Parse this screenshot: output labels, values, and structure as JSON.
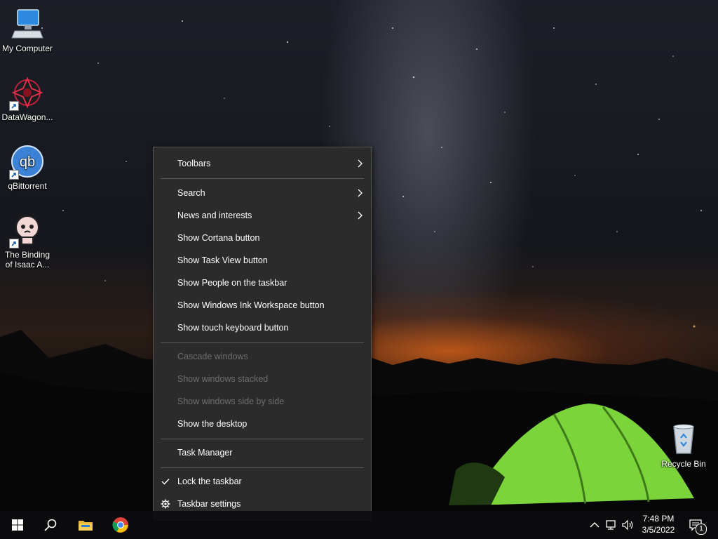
{
  "desktop": {
    "icons": [
      {
        "label": "My Computer",
        "icon": "computer-icon"
      },
      {
        "label": "DataWagon...",
        "icon": "datawagon-icon"
      },
      {
        "label": "qBittorrent",
        "icon": "qbittorrent-icon"
      },
      {
        "label": "The Binding of Isaac A...",
        "icon": "isaac-icon"
      }
    ],
    "recycle_bin": {
      "label": "Recycle Bin",
      "icon": "recycle-bin-icon"
    }
  },
  "context_menu": {
    "items": [
      {
        "label": "Toolbars",
        "submenu": true,
        "enabled": true
      },
      {
        "label": "Search",
        "submenu": true,
        "enabled": true
      },
      {
        "label": "News and interests",
        "submenu": true,
        "enabled": true
      },
      {
        "label": "Show Cortana button",
        "enabled": true
      },
      {
        "label": "Show Task View button",
        "enabled": true
      },
      {
        "label": "Show People on the taskbar",
        "enabled": true
      },
      {
        "label": "Show Windows Ink Workspace button",
        "enabled": true
      },
      {
        "label": "Show touch keyboard button",
        "enabled": true
      },
      {
        "label": "Cascade windows",
        "enabled": false
      },
      {
        "label": "Show windows stacked",
        "enabled": false
      },
      {
        "label": "Show windows side by side",
        "enabled": false
      },
      {
        "label": "Show the desktop",
        "enabled": true
      },
      {
        "label": "Task Manager",
        "enabled": true
      },
      {
        "label": "Lock the taskbar",
        "enabled": true,
        "checked": true
      },
      {
        "label": "Taskbar settings",
        "enabled": true,
        "icon": "gear-icon"
      }
    ]
  },
  "taskbar": {
    "buttons": [
      "windows-start-icon",
      "search-icon",
      "file-explorer-icon",
      "chrome-icon"
    ],
    "tray": [
      "chevron-up-icon",
      "network-icon",
      "volume-icon"
    ],
    "time": "7:48 PM",
    "date": "3/5/2022",
    "notification_count": "1"
  },
  "colors": {
    "menu_bg": "#2b2b2b",
    "menu_disabled_text": "#6e6e6e",
    "tent_green": "#7bd43a"
  }
}
